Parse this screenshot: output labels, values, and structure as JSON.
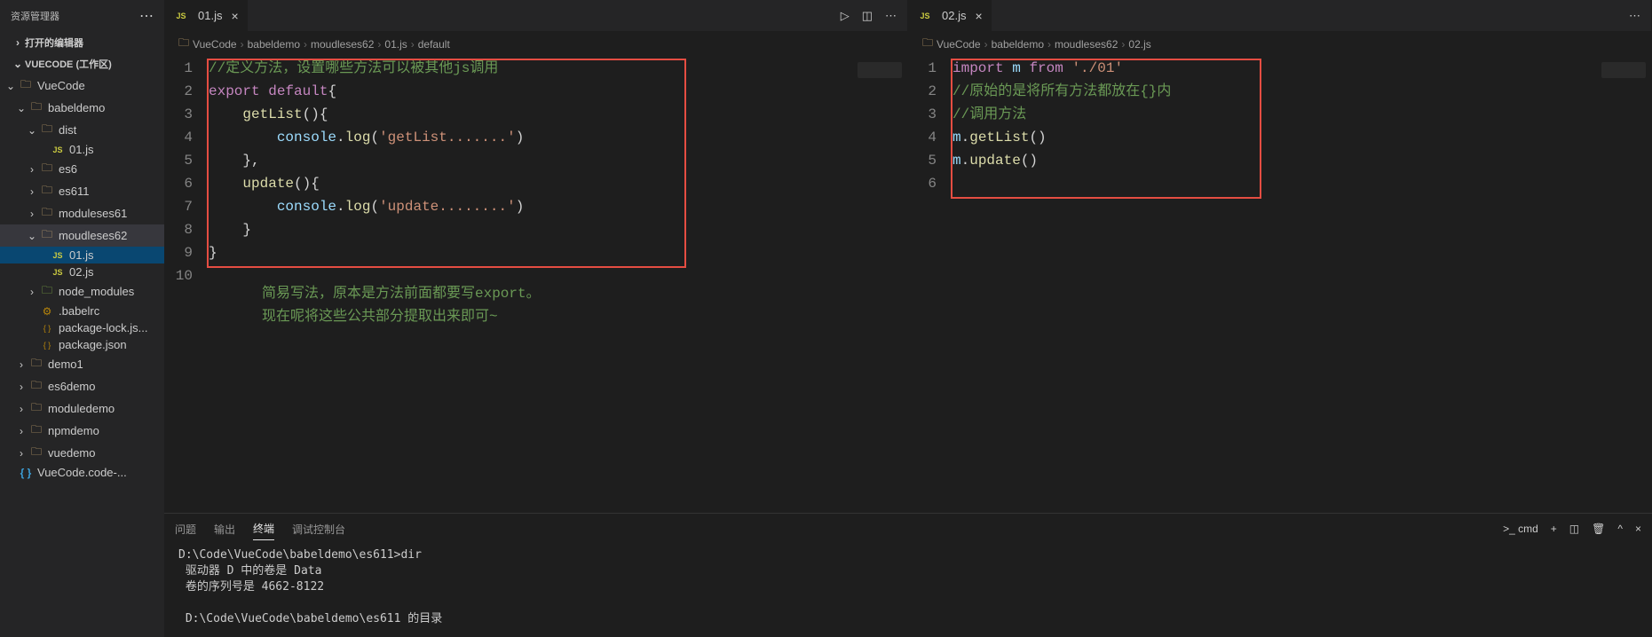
{
  "sidebar": {
    "title": "资源管理器",
    "sections": {
      "open_editors": "打开的编辑器",
      "workspace": "VUECODE (工作区)"
    },
    "tree": [
      {
        "label": "VueCode",
        "depth": 0,
        "type": "folder",
        "expanded": true
      },
      {
        "label": "babeldemo",
        "depth": 1,
        "type": "folder",
        "expanded": true
      },
      {
        "label": "dist",
        "depth": 2,
        "type": "folder",
        "expanded": true
      },
      {
        "label": "01.js",
        "depth": 3,
        "type": "js"
      },
      {
        "label": "es6",
        "depth": 2,
        "type": "folder",
        "expanded": false
      },
      {
        "label": "es611",
        "depth": 2,
        "type": "folder",
        "expanded": false
      },
      {
        "label": "moduleses61",
        "depth": 2,
        "type": "folder",
        "expanded": false
      },
      {
        "label": "moudleses62",
        "depth": 2,
        "type": "folder",
        "expanded": true,
        "selected": true
      },
      {
        "label": "01.js",
        "depth": 3,
        "type": "js",
        "active": true
      },
      {
        "label": "02.js",
        "depth": 3,
        "type": "js"
      },
      {
        "label": "node_modules",
        "depth": 2,
        "type": "folder-green",
        "expanded": false
      },
      {
        "label": ".babelrc",
        "depth": 2,
        "type": "config"
      },
      {
        "label": "package-lock.js...",
        "depth": 2,
        "type": "json"
      },
      {
        "label": "package.json",
        "depth": 2,
        "type": "json"
      },
      {
        "label": "demo1",
        "depth": 1,
        "type": "folder",
        "expanded": false
      },
      {
        "label": "es6demo",
        "depth": 1,
        "type": "folder",
        "expanded": false
      },
      {
        "label": "moduledemo",
        "depth": 1,
        "type": "folder",
        "expanded": false
      },
      {
        "label": "npmdemo",
        "depth": 1,
        "type": "folder",
        "expanded": false
      },
      {
        "label": "vuedemo",
        "depth": 1,
        "type": "folder",
        "expanded": false
      },
      {
        "label": "VueCode.code-...",
        "depth": 0,
        "type": "brace"
      }
    ]
  },
  "editor1": {
    "tab": "01.js",
    "breadcrumb": [
      "VueCode",
      "babeldemo",
      "moudleses62",
      "01.js",
      "default"
    ],
    "lines": [
      {
        "n": "1",
        "tokens": [
          {
            "t": "//定义方法，设置哪些方法可以被其他js调用",
            "c": "tk-comment"
          }
        ]
      },
      {
        "n": "2",
        "tokens": [
          {
            "t": "export",
            "c": "tk-keyword"
          },
          {
            "t": " ",
            "c": ""
          },
          {
            "t": "default",
            "c": "tk-keyword"
          },
          {
            "t": "{",
            "c": "tk-punct"
          }
        ]
      },
      {
        "n": "3",
        "tokens": [
          {
            "t": "    ",
            "c": ""
          },
          {
            "t": "getList",
            "c": "tk-func"
          },
          {
            "t": "(){",
            "c": "tk-punct"
          }
        ]
      },
      {
        "n": "4",
        "tokens": [
          {
            "t": "        ",
            "c": ""
          },
          {
            "t": "console",
            "c": "tk-var"
          },
          {
            "t": ".",
            "c": "tk-punct"
          },
          {
            "t": "log",
            "c": "tk-func"
          },
          {
            "t": "(",
            "c": "tk-punct"
          },
          {
            "t": "'getList.......'",
            "c": "tk-string"
          },
          {
            "t": ")",
            "c": "tk-punct"
          }
        ]
      },
      {
        "n": "5",
        "tokens": [
          {
            "t": "    },",
            "c": "tk-punct"
          }
        ]
      },
      {
        "n": "6",
        "tokens": [
          {
            "t": "    ",
            "c": ""
          },
          {
            "t": "update",
            "c": "tk-func"
          },
          {
            "t": "(){",
            "c": "tk-punct"
          }
        ]
      },
      {
        "n": "7",
        "tokens": [
          {
            "t": "        ",
            "c": ""
          },
          {
            "t": "console",
            "c": "tk-var"
          },
          {
            "t": ".",
            "c": "tk-punct"
          },
          {
            "t": "log",
            "c": "tk-func"
          },
          {
            "t": "(",
            "c": "tk-punct"
          },
          {
            "t": "'update........'",
            "c": "tk-string"
          },
          {
            "t": ")",
            "c": "tk-punct"
          }
        ]
      },
      {
        "n": "8",
        "tokens": [
          {
            "t": "    }",
            "c": "tk-punct"
          }
        ]
      },
      {
        "n": "9",
        "tokens": [
          {
            "t": "}",
            "c": "tk-punct"
          }
        ]
      },
      {
        "n": "10",
        "tokens": [
          {
            "t": "",
            "c": ""
          }
        ]
      }
    ],
    "annotation1": "简易写法，原本是方法前面都要写export。",
    "annotation2": "现在呢将这些公共部分提取出来即可~"
  },
  "editor2": {
    "tab": "02.js",
    "breadcrumb": [
      "VueCode",
      "babeldemo",
      "moudleses62",
      "02.js"
    ],
    "lines": [
      {
        "n": "1",
        "tokens": [
          {
            "t": "import",
            "c": "tk-keyword"
          },
          {
            "t": " ",
            "c": ""
          },
          {
            "t": "m",
            "c": "tk-var"
          },
          {
            "t": " ",
            "c": ""
          },
          {
            "t": "from",
            "c": "tk-keyword"
          },
          {
            "t": " ",
            "c": ""
          },
          {
            "t": "'./01'",
            "c": "tk-string"
          }
        ]
      },
      {
        "n": "2",
        "tokens": [
          {
            "t": "//原始的是将所有方法都放在{}内",
            "c": "tk-comment"
          }
        ]
      },
      {
        "n": "3",
        "tokens": [
          {
            "t": "",
            "c": ""
          }
        ]
      },
      {
        "n": "4",
        "tokens": [
          {
            "t": "//调用方法",
            "c": "tk-comment"
          }
        ]
      },
      {
        "n": "5",
        "tokens": [
          {
            "t": "m",
            "c": "tk-var"
          },
          {
            "t": ".",
            "c": "tk-punct"
          },
          {
            "t": "getList",
            "c": "tk-func"
          },
          {
            "t": "()",
            "c": "tk-punct"
          }
        ]
      },
      {
        "n": "6",
        "tokens": [
          {
            "t": "m",
            "c": "tk-var"
          },
          {
            "t": ".",
            "c": "tk-punct"
          },
          {
            "t": "update",
            "c": "tk-func"
          },
          {
            "t": "()",
            "c": "tk-punct"
          }
        ]
      }
    ]
  },
  "terminal": {
    "tabs": {
      "problems": "问题",
      "output": "输出",
      "terminal": "终端",
      "debug": "调试控制台"
    },
    "shell": "cmd",
    "body": "D:\\Code\\VueCode\\babeldemo\\es611>dir\n 驱动器 D 中的卷是 Data\n 卷的序列号是 4662-8122\n\n D:\\Code\\VueCode\\babeldemo\\es611 的目录"
  }
}
